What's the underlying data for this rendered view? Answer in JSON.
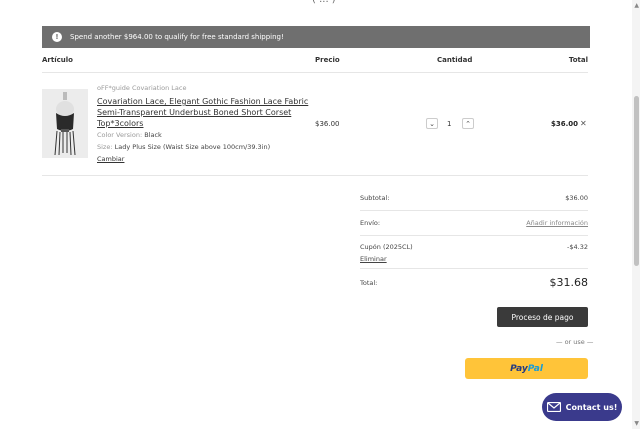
{
  "header": {
    "top_fragment": "( ... )"
  },
  "banner": {
    "text": "Spend another $964.00 to qualify for free standard shipping!"
  },
  "table": {
    "col_article": "Artículo",
    "col_price": "Precio",
    "col_qty": "Cantidad",
    "col_total": "Total"
  },
  "item": {
    "vendor": "oFF*guide Covariation Lace",
    "title": "Covariation Lace, Elegant Gothic Fashion Lace Fabric Semi-Transparent Underbust Boned Short Corset Top*3colors",
    "color_key": "Color Version:",
    "color_val": "Black",
    "size_key": "Size:",
    "size_val": "Lady Plus Size (Waist Size above 100cm/39.3in)",
    "change": "Cambiar",
    "price": "$36.00",
    "qty": "1",
    "line_total": "$36.00"
  },
  "summary": {
    "subtotal_label": "Subtotal:",
    "subtotal_value": "$36.00",
    "shipping_label": "Envío:",
    "shipping_value": "Añadir información",
    "coupon_label": "Cupón (2025CL)",
    "coupon_value": "-$4.32",
    "coupon_remove": "Eliminar",
    "total_label": "Total:",
    "total_value": "$31.68"
  },
  "actions": {
    "checkout": "Proceso de pago",
    "or_use": "— or use —",
    "paypal_pay": "Pay",
    "paypal_pal": "Pal",
    "contact": "Contact us!"
  },
  "colors": {
    "banner_bg": "#6f6f6f",
    "checkout_bg": "#3a3a3a",
    "paypal_bg": "#ffc439",
    "contact_bg": "#3a3a8c"
  }
}
